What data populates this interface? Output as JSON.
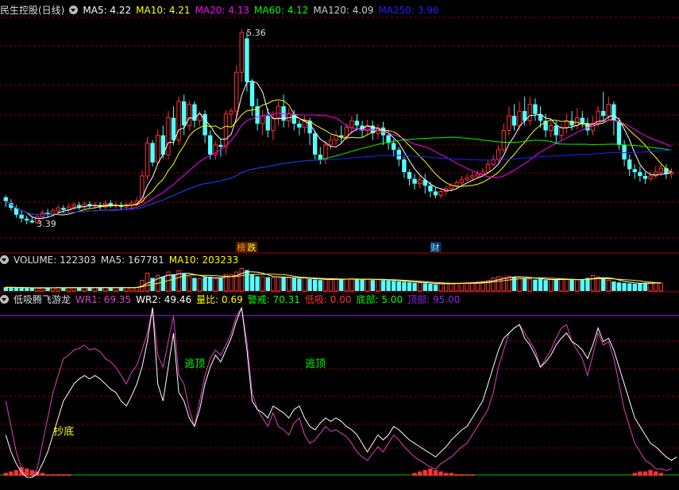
{
  "colors": {
    "bg": "#000000",
    "up": "#ff3232",
    "down": "#54ffff",
    "grid": "#8b0000",
    "ma5": "#ffffff",
    "ma10": "#ffff00",
    "ma20": "#ff00ff",
    "ma60": "#00ff00",
    "ma120": "#cccccc",
    "ma250": "#2020ff",
    "wr1": "#e040c0",
    "wr2": "#ffffff",
    "label_green": "#00ff00",
    "label_yellow": "#ffff00"
  },
  "header": {
    "stock_title": "民生控股(日线)",
    "ma5": "MA5: 4.22",
    "ma10": "MA10: 4.21",
    "ma20": "MA20: 4.13",
    "ma60": "MA60: 4.12",
    "ma120": "MA120: 4.09",
    "ma250": "MA250: 3.96"
  },
  "volume_header": {
    "volume": "VOLUME: 122303",
    "ma5": "MA5: 167781",
    "ma10": "MA10: 203233"
  },
  "indicator_header": {
    "name": "低吸腾飞游龙",
    "wr1": "WR1: 69.35",
    "wr2": "WR2: 49.46",
    "liangbi": "量比: 0.69",
    "jingjie": "警戒: 70.31",
    "dixi": "低吸: 0.00",
    "dibu": "底部: 5.00",
    "dingbu": "顶部: 95.00"
  },
  "chart_data": [
    {
      "type": "candlestick",
      "title": "民生控股(日线)",
      "ylim": [
        3.2,
        5.5
      ],
      "annotations": [
        {
          "text": "5.36",
          "index": 45,
          "value": 5.36
        },
        {
          "text": "3.39",
          "index": 5,
          "value": 3.39
        }
      ],
      "markers": [
        {
          "text": "榜",
          "index": 45
        },
        {
          "text": "跌",
          "index": 47
        },
        {
          "text": "财",
          "index": 82
        }
      ],
      "candles": [
        [
          3.66,
          3.62,
          3.68,
          3.56
        ],
        [
          3.6,
          3.55,
          3.64,
          3.52
        ],
        [
          3.55,
          3.48,
          3.58,
          3.45
        ],
        [
          3.48,
          3.44,
          3.52,
          3.4
        ],
        [
          3.44,
          3.42,
          3.47,
          3.38
        ],
        [
          3.42,
          3.4,
          3.45,
          3.39
        ],
        [
          3.4,
          3.46,
          3.49,
          3.38
        ],
        [
          3.46,
          3.5,
          3.53,
          3.43
        ],
        [
          3.5,
          3.48,
          3.54,
          3.45
        ],
        [
          3.48,
          3.52,
          3.55,
          3.46
        ],
        [
          3.52,
          3.55,
          3.58,
          3.49
        ],
        [
          3.55,
          3.53,
          3.58,
          3.5
        ],
        [
          3.53,
          3.56,
          3.59,
          3.5
        ],
        [
          3.56,
          3.58,
          3.61,
          3.53
        ],
        [
          3.58,
          3.56,
          3.61,
          3.53
        ],
        [
          3.56,
          3.59,
          3.62,
          3.53
        ],
        [
          3.59,
          3.57,
          3.62,
          3.54
        ],
        [
          3.57,
          3.58,
          3.61,
          3.54
        ],
        [
          3.58,
          3.56,
          3.61,
          3.53
        ],
        [
          3.56,
          3.6,
          3.63,
          3.53
        ],
        [
          3.6,
          3.57,
          3.63,
          3.55
        ],
        [
          3.57,
          3.58,
          3.61,
          3.54
        ],
        [
          3.58,
          3.56,
          3.61,
          3.53
        ],
        [
          3.56,
          3.58,
          3.61,
          3.53
        ],
        [
          3.58,
          3.6,
          3.63,
          3.55
        ],
        [
          3.6,
          3.62,
          3.66,
          3.57
        ],
        [
          3.62,
          3.88,
          3.94,
          3.6
        ],
        [
          3.88,
          4.22,
          4.28,
          3.84
        ],
        [
          4.22,
          4.02,
          4.25,
          3.98
        ],
        [
          4.02,
          4.3,
          4.36,
          4.0
        ],
        [
          4.3,
          4.1,
          4.4,
          4.06
        ],
        [
          4.1,
          4.48,
          4.55,
          4.05
        ],
        [
          4.48,
          4.25,
          4.6,
          4.2
        ],
        [
          4.25,
          4.65,
          4.7,
          4.2
        ],
        [
          4.65,
          4.4,
          4.72,
          4.3
        ],
        [
          4.4,
          4.62,
          4.66,
          4.35
        ],
        [
          4.62,
          4.45,
          4.65,
          4.38
        ],
        [
          4.45,
          4.52,
          4.55,
          4.4
        ],
        [
          4.52,
          4.3,
          4.56,
          4.22
        ],
        [
          4.3,
          4.1,
          4.35,
          4.05
        ],
        [
          4.1,
          4.2,
          4.24,
          4.05
        ],
        [
          4.2,
          4.18,
          4.26,
          4.08
        ],
        [
          4.18,
          4.52,
          4.56,
          4.1
        ],
        [
          4.52,
          4.55,
          4.58,
          4.4
        ],
        [
          4.55,
          4.95,
          5.02,
          4.45
        ],
        [
          4.95,
          5.36,
          5.4,
          4.85
        ],
        [
          5.3,
          4.85,
          5.36,
          4.75
        ],
        [
          4.85,
          4.6,
          4.88,
          4.5
        ],
        [
          4.6,
          4.42,
          4.68,
          4.35
        ],
        [
          4.42,
          4.5,
          4.56,
          4.3
        ],
        [
          4.5,
          4.35,
          4.58,
          4.28
        ],
        [
          4.35,
          4.48,
          4.55,
          4.25
        ],
        [
          4.48,
          4.6,
          4.65,
          4.4
        ],
        [
          4.6,
          4.45,
          4.72,
          4.38
        ],
        [
          4.45,
          4.52,
          4.58,
          4.38
        ],
        [
          4.52,
          4.42,
          4.56,
          4.35
        ],
        [
          4.42,
          4.38,
          4.46,
          4.3
        ],
        [
          4.38,
          4.45,
          4.5,
          4.32
        ],
        [
          4.45,
          4.32,
          4.48,
          4.2
        ],
        [
          4.32,
          4.1,
          4.35,
          4.05
        ],
        [
          4.1,
          4.05,
          4.18,
          4.0
        ],
        [
          4.05,
          4.2,
          4.25,
          4.0
        ],
        [
          4.2,
          4.25,
          4.3,
          4.15
        ],
        [
          4.25,
          4.3,
          4.35,
          4.2
        ],
        [
          4.3,
          4.28,
          4.4,
          4.22
        ],
        [
          4.28,
          4.38,
          4.42,
          4.25
        ],
        [
          4.38,
          4.45,
          4.5,
          4.32
        ],
        [
          4.45,
          4.4,
          4.52,
          4.35
        ],
        [
          4.4,
          4.35,
          4.45,
          4.28
        ],
        [
          4.35,
          4.4,
          4.46,
          4.3
        ],
        [
          4.4,
          4.32,
          4.45,
          4.25
        ],
        [
          4.32,
          4.38,
          4.42,
          4.26
        ],
        [
          4.38,
          4.3,
          4.44,
          4.2
        ],
        [
          4.3,
          4.22,
          4.35,
          4.15
        ],
        [
          4.22,
          4.15,
          4.26,
          4.08
        ],
        [
          4.15,
          4.05,
          4.18,
          3.98
        ],
        [
          4.05,
          3.92,
          4.08,
          3.86
        ],
        [
          3.92,
          3.85,
          3.95,
          3.78
        ],
        [
          3.85,
          3.8,
          3.9,
          3.74
        ],
        [
          3.8,
          3.84,
          3.88,
          3.75
        ],
        [
          3.84,
          3.78,
          3.9,
          3.7
        ],
        [
          3.78,
          3.72,
          3.82,
          3.66
        ],
        [
          3.72,
          3.68,
          3.76,
          3.65
        ],
        [
          3.68,
          3.72,
          3.75,
          3.65
        ],
        [
          3.72,
          3.75,
          3.78,
          3.68
        ],
        [
          3.75,
          3.78,
          3.81,
          3.72
        ],
        [
          3.78,
          3.81,
          3.84,
          3.75
        ],
        [
          3.81,
          3.84,
          3.88,
          3.79
        ],
        [
          3.84,
          3.86,
          3.9,
          3.82
        ],
        [
          3.86,
          3.88,
          3.92,
          3.84
        ],
        [
          3.88,
          3.9,
          3.94,
          3.86
        ],
        [
          3.9,
          3.92,
          3.96,
          3.88
        ],
        [
          3.92,
          4.0,
          4.04,
          3.9
        ],
        [
          4.0,
          4.05,
          4.1,
          3.98
        ],
        [
          4.05,
          4.15,
          4.2,
          4.02
        ],
        [
          4.15,
          4.35,
          4.42,
          4.12
        ],
        [
          4.35,
          4.5,
          4.6,
          4.3
        ],
        [
          4.5,
          4.4,
          4.62,
          4.35
        ],
        [
          4.4,
          4.55,
          4.65,
          4.35
        ],
        [
          4.55,
          4.45,
          4.7,
          4.4
        ],
        [
          4.45,
          4.62,
          4.7,
          4.4
        ],
        [
          4.62,
          4.52,
          4.68,
          4.45
        ],
        [
          4.52,
          4.45,
          4.6,
          4.38
        ],
        [
          4.45,
          4.35,
          4.52,
          4.28
        ],
        [
          4.35,
          4.4,
          4.45,
          4.28
        ],
        [
          4.4,
          4.3,
          4.45,
          4.22
        ],
        [
          4.3,
          4.38,
          4.42,
          4.25
        ],
        [
          4.38,
          4.45,
          4.52,
          4.32
        ],
        [
          4.45,
          4.4,
          4.55,
          4.35
        ],
        [
          4.4,
          4.48,
          4.58,
          4.36
        ],
        [
          4.48,
          4.42,
          4.55,
          4.38
        ],
        [
          4.42,
          4.35,
          4.48,
          4.3
        ],
        [
          4.35,
          4.42,
          4.5,
          4.3
        ],
        [
          4.42,
          4.55,
          4.6,
          4.38
        ],
        [
          4.55,
          4.5,
          4.75,
          4.45
        ],
        [
          4.5,
          4.62,
          4.7,
          4.45
        ],
        [
          4.62,
          4.45,
          4.65,
          4.3
        ],
        [
          4.45,
          4.2,
          4.48,
          4.15
        ],
        [
          4.2,
          4.05,
          4.25,
          3.98
        ],
        [
          4.05,
          3.95,
          4.1,
          3.88
        ],
        [
          3.95,
          3.92,
          4.0,
          3.85
        ],
        [
          3.92,
          3.88,
          3.98,
          3.82
        ],
        [
          3.88,
          3.85,
          3.92,
          3.8
        ],
        [
          3.85,
          3.88,
          3.93,
          3.82
        ],
        [
          3.88,
          3.92,
          3.98,
          3.85
        ],
        [
          3.92,
          3.96,
          4.0,
          3.88
        ],
        [
          3.96,
          3.9,
          4.0,
          3.85
        ],
        [
          3.9,
          3.92,
          3.96,
          3.86
        ]
      ]
    },
    {
      "type": "bar",
      "title": "VOLUME",
      "values": [
        16,
        15,
        14,
        13,
        12,
        12,
        13,
        14,
        13,
        14,
        15,
        14,
        14,
        15,
        14,
        15,
        14,
        14,
        14,
        15,
        14,
        14,
        14,
        14,
        15,
        16,
        45,
        75,
        55,
        65,
        60,
        80,
        70,
        85,
        75,
        60,
        55,
        52,
        58,
        60,
        52,
        55,
        70,
        68,
        80,
        95,
        88,
        70,
        62,
        60,
        58,
        55,
        60,
        58,
        56,
        54,
        52,
        55,
        50,
        48,
        46,
        48,
        50,
        52,
        48,
        50,
        52,
        50,
        48,
        50,
        46,
        48,
        45,
        44,
        42,
        40,
        38,
        36,
        34,
        35,
        32,
        30,
        28,
        30,
        31,
        32,
        33,
        34,
        35,
        36,
        38,
        40,
        45,
        55,
        60,
        58,
        62,
        60,
        58,
        55,
        50,
        48,
        50,
        46,
        48,
        50,
        48,
        50,
        48,
        46,
        48,
        55,
        65,
        60,
        50,
        45,
        40,
        36,
        34,
        32,
        30,
        32,
        34,
        36,
        34,
        33
      ],
      "ylim": [
        0,
        100
      ]
    },
    {
      "type": "line",
      "title": "低吸腾飞游龙",
      "ylim": [
        0,
        100
      ],
      "labels": [
        {
          "text": "抄底",
          "index": 10,
          "value": 25
        },
        {
          "text": "逃顶",
          "index": 35,
          "value": 65
        },
        {
          "text": "逃顶",
          "index": 58,
          "value": 65
        }
      ],
      "series": [
        {
          "name": "WR1",
          "values": [
            45,
            30,
            15,
            5,
            0,
            0,
            5,
            20,
            35,
            50,
            60,
            70,
            72,
            75,
            76,
            78,
            75,
            76,
            74,
            70,
            68,
            65,
            60,
            55,
            62,
            66,
            75,
            85,
            100,
            72,
            65,
            80,
            95,
            60,
            55,
            40,
            30,
            45,
            60,
            70,
            75,
            72,
            78,
            85,
            95,
            100,
            80,
            50,
            40,
            35,
            30,
            38,
            30,
            28,
            25,
            32,
            35,
            25,
            20,
            22,
            26,
            30,
            27,
            28,
            26,
            24,
            20,
            15,
            12,
            10,
            14,
            18,
            15,
            20,
            25,
            22,
            18,
            15,
            12,
            10,
            8,
            6,
            5,
            8,
            10,
            12,
            15,
            18,
            20,
            25,
            30,
            35,
            40,
            50,
            65,
            75,
            85,
            88,
            90,
            85,
            80,
            75,
            65,
            70,
            75,
            82,
            88,
            90,
            80,
            75,
            70,
            60,
            72,
            85,
            78,
            80,
            70,
            55,
            40,
            30,
            20,
            15,
            10,
            8,
            5,
            5,
            4,
            5
          ]
        },
        {
          "name": "WR2",
          "values": [
            25,
            15,
            8,
            3,
            0,
            0,
            2,
            8,
            15,
            25,
            35,
            45,
            50,
            55,
            58,
            60,
            58,
            60,
            58,
            55,
            52,
            50,
            45,
            42,
            48,
            55,
            65,
            80,
            100,
            55,
            45,
            65,
            85,
            50,
            45,
            35,
            30,
            40,
            55,
            65,
            72,
            68,
            75,
            82,
            92,
            100,
            75,
            45,
            40,
            38,
            35,
            42,
            40,
            38,
            35,
            40,
            42,
            35,
            30,
            28,
            32,
            35,
            33,
            35,
            33,
            30,
            28,
            25,
            20,
            15,
            20,
            25,
            22,
            25,
            30,
            28,
            25,
            22,
            20,
            18,
            16,
            14,
            12,
            15,
            18,
            22,
            25,
            28,
            30,
            35,
            40,
            45,
            55,
            65,
            75,
            82,
            85,
            88,
            90,
            82,
            78,
            72,
            65,
            68,
            72,
            78,
            82,
            85,
            80,
            78,
            75,
            70,
            78,
            88,
            80,
            82,
            75,
            65,
            55,
            45,
            35,
            30,
            25,
            20,
            18,
            15,
            12,
            10,
            12
          ]
        }
      ],
      "bars": [
        2,
        3,
        4,
        6,
        5,
        4,
        3,
        2,
        1,
        1,
        1,
        1,
        1,
        0,
        0,
        0,
        0,
        0,
        0,
        0,
        0,
        0,
        0,
        0,
        0,
        0,
        0,
        0,
        0,
        0,
        0,
        0,
        0,
        0,
        0,
        0,
        0,
        0,
        0,
        0,
        0,
        0,
        0,
        0,
        0,
        0,
        0,
        0,
        0,
        0,
        0,
        0,
        0,
        0,
        0,
        0,
        0,
        0,
        0,
        0,
        0,
        0,
        0,
        0,
        0,
        0,
        0,
        0,
        0,
        0,
        0,
        0,
        0,
        0,
        0,
        0,
        0,
        0,
        2,
        3,
        4,
        5,
        4,
        3,
        2,
        2,
        1,
        1,
        1,
        1,
        0,
        0,
        0,
        0,
        0,
        0,
        0,
        0,
        0,
        0,
        0,
        0,
        0,
        0,
        0,
        0,
        0,
        0,
        0,
        0,
        0,
        0,
        0,
        0,
        0,
        0,
        0,
        0,
        0,
        0,
        2,
        3,
        3,
        4,
        3,
        2
      ]
    }
  ]
}
